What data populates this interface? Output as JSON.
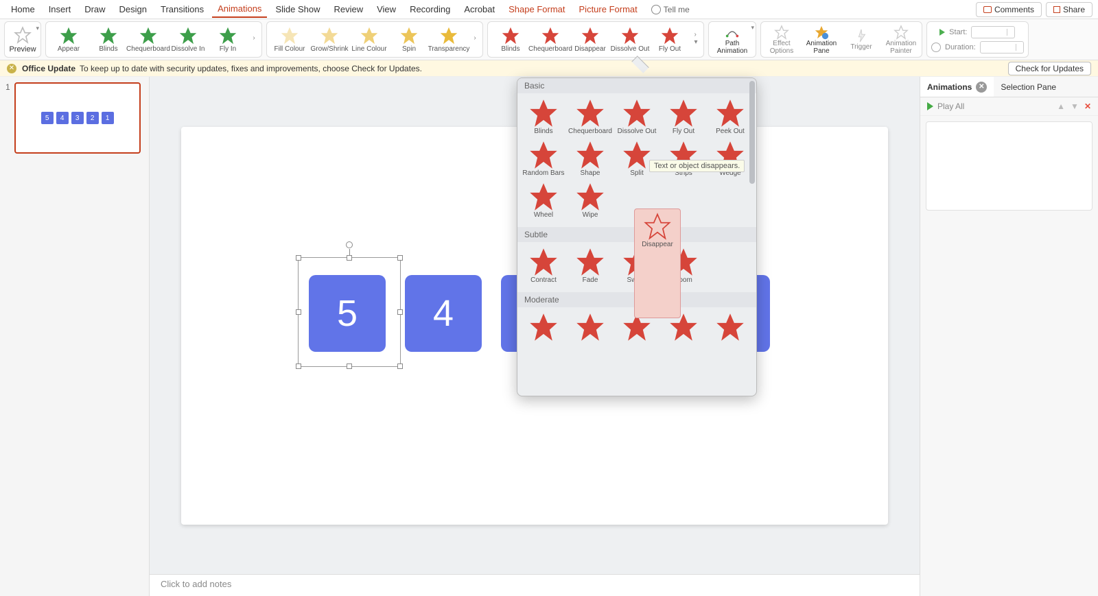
{
  "tabs": {
    "home": "Home",
    "insert": "Insert",
    "draw": "Draw",
    "design": "Design",
    "transitions": "Transitions",
    "animations": "Animations",
    "slideshow": "Slide Show",
    "review": "Review",
    "view": "View",
    "recording": "Recording",
    "acrobat": "Acrobat",
    "shape_format": "Shape Format",
    "picture_format": "Picture Format",
    "tell_me": "Tell me"
  },
  "top_right": {
    "comments": "Comments",
    "share": "Share"
  },
  "ribbon": {
    "preview": "Preview",
    "entrance": [
      "Appear",
      "Blinds",
      "Chequerboard",
      "Dissolve In",
      "Fly In"
    ],
    "emphasis": [
      "Fill Colour",
      "Grow/Shrink",
      "Line Colour",
      "Spin",
      "Transparency"
    ],
    "exit": [
      "Blinds",
      "Chequerboard",
      "Disappear",
      "Dissolve Out",
      "Fly Out"
    ],
    "path": "Path Animation",
    "effect_options": "Effect Options",
    "anim_pane": "Animation Pane",
    "trigger": "Trigger",
    "painter": "Animation Painter",
    "start": "Start:",
    "duration": "Duration:"
  },
  "update": {
    "title": "Office Update",
    "msg": "To keep up to date with security updates, fixes and improvements, choose Check for Updates.",
    "btn": "Check for Updates"
  },
  "slide": {
    "number": "1",
    "boxes": [
      "5",
      "4",
      "3",
      "2",
      "1"
    ],
    "notes": "Click to add notes"
  },
  "right_pane": {
    "tab_anim": "Animations",
    "tab_sel": "Selection Pane",
    "play": "Play All"
  },
  "gallery": {
    "cat_basic": "Basic",
    "cat_subtle": "Subtle",
    "cat_moderate": "Moderate",
    "basic": [
      "Blinds",
      "Chequerboard",
      "Disappear",
      "Dissolve Out",
      "Fly Out",
      "Peek Out",
      "Random Bars",
      "Shape",
      "Split",
      "Strips",
      "Wedge",
      "Wheel",
      "Wipe"
    ],
    "subtle": [
      "Contract",
      "Fade",
      "Swivel",
      "Zoom"
    ],
    "tooltip": "Text or object disappears."
  },
  "colors": {
    "entrance": "#3d9e4a",
    "emphasis": "#e8b730",
    "exit": "#d6453a",
    "accent": "#c43e1c",
    "box": "#6174e8"
  }
}
